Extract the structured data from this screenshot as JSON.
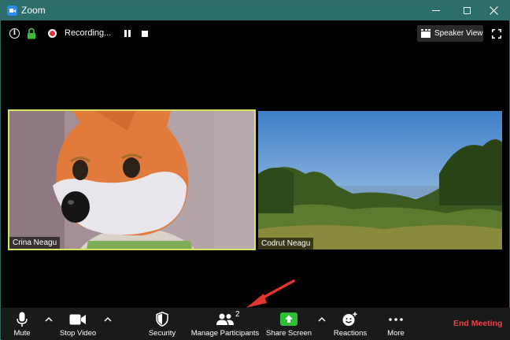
{
  "window": {
    "title": "Zoom"
  },
  "top_bar": {
    "recording_label": "Recording...",
    "speaker_view_label": "Speaker View"
  },
  "participants": [
    {
      "name": "Crina Neagu"
    },
    {
      "name": "Codrut Neagu"
    }
  ],
  "toolbar": {
    "mute_label": "Mute",
    "stop_video_label": "Stop Video",
    "security_label": "Security",
    "manage_participants_label": "Manage Participants",
    "participant_count": "2",
    "share_screen_label": "Share Screen",
    "reactions_label": "Reactions",
    "more_label": "More",
    "end_meeting_label": "End Meeting"
  },
  "colors": {
    "titlebar": "#2d6e6b",
    "active_speaker_border": "#d6e35e",
    "share_screen_green": "#2dbf3a",
    "end_meeting_red": "#e6434a",
    "annotation_arrow": "#e3342f"
  }
}
